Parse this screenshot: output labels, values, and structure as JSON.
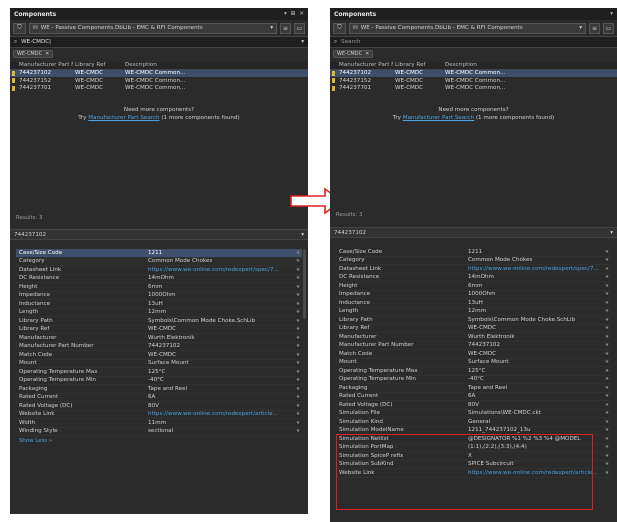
{
  "left_panel": {
    "title": "Components",
    "title_controls": [
      "▾",
      "⊞",
      "✕"
    ],
    "library": "WE - Passive Components.DbLib - EMC & RFI Components",
    "search_value": "WE-CMDC|",
    "filter_chip": "WE-CMDC",
    "columns": [
      "Manufacturer Part N",
      "Library Ref",
      "Description"
    ],
    "rows": [
      {
        "part": "744237102",
        "ref": "WE-CMDC",
        "desc": "WE-CMDC Common..."
      },
      {
        "part": "744237152",
        "ref": "WE-CMDC",
        "desc": "WE-CMDC Common..."
      },
      {
        "part": "744237701",
        "ref": "WE-CMDC",
        "desc": "WE-CMDC Common..."
      }
    ],
    "need_more": "Need more components?",
    "try_prefix": "Try",
    "try_link": "Manufacturer Part Search",
    "try_suffix": "(1 more components found)",
    "results": "Results: 3",
    "selected_part": "744237102",
    "properties": [
      {
        "k": "Case/Size Code",
        "v": "1211"
      },
      {
        "k": "Category",
        "v": "Common Mode Chokes"
      },
      {
        "k": "Datasheet Link",
        "v": "https://www.we-online.com/redexpert/spec/7...",
        "link": true
      },
      {
        "k": "DC Resistance",
        "v": "14mOhm"
      },
      {
        "k": "Height",
        "v": "6mm"
      },
      {
        "k": "Impedance",
        "v": "1000Ohm"
      },
      {
        "k": "Inductance",
        "v": "13uH"
      },
      {
        "k": "Length",
        "v": "12mm"
      },
      {
        "k": "Library Path",
        "v": "Symbols\\Common Mode Choke.SchLib"
      },
      {
        "k": "Library Ref",
        "v": "WE-CMDC"
      },
      {
        "k": "Manufacturer",
        "v": "Wurth Elektronik"
      },
      {
        "k": "Manufacturer Part Number",
        "v": "744237102"
      },
      {
        "k": "Match Code",
        "v": "WE-CMDC"
      },
      {
        "k": "Mount",
        "v": "Surface Mount"
      },
      {
        "k": "Operating Temperature Max",
        "v": "125°C"
      },
      {
        "k": "Operating Temperature Min",
        "v": "-40°C"
      },
      {
        "k": "Packaging",
        "v": "Tape and Reel"
      },
      {
        "k": "Rated Current",
        "v": "6A"
      },
      {
        "k": "Rated Voltage (DC)",
        "v": "80V"
      },
      {
        "k": "Website Link",
        "v": "https://www.we-online.com/redexpert/article...",
        "link": true
      },
      {
        "k": "Width",
        "v": "11mm"
      },
      {
        "k": "Winding Style",
        "v": "sectional"
      }
    ],
    "show_less": "Show Less »"
  },
  "right_panel": {
    "title": "Components",
    "title_controls": [
      "▾"
    ],
    "library": "WE - Passive Components.DbLib - EMC & RFI Components",
    "search_placeholder": "Search",
    "filter_chip": "WE-CMDC",
    "columns": [
      "Manufacturer Part N",
      "Library Ref",
      "Description"
    ],
    "rows": [
      {
        "part": "744237102",
        "ref": "WE-CMDC",
        "desc": "WE-CMDC Common..."
      },
      {
        "part": "744237152",
        "ref": "WE-CMDC",
        "desc": "WE-CMDC Common..."
      },
      {
        "part": "744237701",
        "ref": "WE-CMDC",
        "desc": "WE-CMDC Common..."
      }
    ],
    "need_more": "Need more components?",
    "try_prefix": "Try",
    "try_link": "Manufacturer Part Search",
    "try_suffix": "(1 more components found)",
    "results": "Results: 3",
    "selected_part": "744237102",
    "properties": [
      {
        "k": "Case/Size Code",
        "v": "1211"
      },
      {
        "k": "Category",
        "v": "Common Mode Chokes"
      },
      {
        "k": "Datasheet Link",
        "v": "https://www.we-online.com/redexpert/spec/7...",
        "link": true
      },
      {
        "k": "DC Resistance",
        "v": "14mOhm"
      },
      {
        "k": "Height",
        "v": "6mm"
      },
      {
        "k": "Impedance",
        "v": "1000Ohm"
      },
      {
        "k": "Inductance",
        "v": "13uH"
      },
      {
        "k": "Length",
        "v": "12mm"
      },
      {
        "k": "Library Path",
        "v": "Symbols\\Common Mode Choke.SchLib"
      },
      {
        "k": "Library Ref",
        "v": "WE-CMDC"
      },
      {
        "k": "Manufacturer",
        "v": "Wurth Elektronik"
      },
      {
        "k": "Manufacturer Part Number",
        "v": "744237102"
      },
      {
        "k": "Match Code",
        "v": "WE-CMDC"
      },
      {
        "k": "Mount",
        "v": "Surface Mount"
      },
      {
        "k": "Operating Temperature Max",
        "v": "125°C"
      },
      {
        "k": "Operating Temperature Min",
        "v": "-40°C"
      },
      {
        "k": "Packaging",
        "v": "Tape and Reel"
      },
      {
        "k": "Rated Current",
        "v": "6A"
      },
      {
        "k": "Rated Voltage (DC)",
        "v": "80V"
      },
      {
        "k": "Simulation File",
        "v": "Simulations\\WE-CMDC.ckt"
      },
      {
        "k": "Simulation Kind",
        "v": "General"
      },
      {
        "k": "Simulation ModelName",
        "v": "1211_744237102_13u"
      },
      {
        "k": "Simulation Netlist",
        "v": "@DESIGNATOR %1 %2 %3 %4 @MODEL"
      },
      {
        "k": "Simulation PortMap",
        "v": "(1:1),(2:2),(3:3),(4:4)"
      },
      {
        "k": "Simulation SpiceP refix",
        "v": "X"
      },
      {
        "k": "Simulation SubKind",
        "v": "SPICE Subcircuit"
      },
      {
        "k": "Website Link",
        "v": "https://www.we-online.com/redexpert/article...",
        "link": true
      }
    ]
  },
  "colors": {
    "panel_bg": "#2b2b2b",
    "selection": "#3e4f6b",
    "link": "#4ea3e0",
    "icon_yellow": "#e5b626",
    "highlight_box": "#e02020",
    "arrow": "#e02020"
  },
  "icons": {
    "filter": "funnel-icon",
    "library": "database-icon",
    "search": "magnifier-icon",
    "arrow": "right-arrow-icon"
  }
}
